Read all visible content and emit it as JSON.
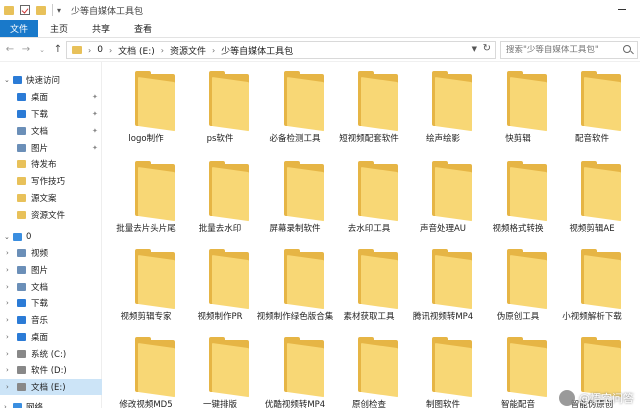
{
  "window": {
    "title": "少等自媒体工具包"
  },
  "ribbon": {
    "tabs": [
      "文件",
      "主页",
      "共享",
      "查看"
    ]
  },
  "address": {
    "crumbs": [
      "0",
      "文档 (E:)",
      "资源文件",
      "少等自媒体工具包"
    ],
    "search_placeholder": "搜索\"少等自媒体工具包\""
  },
  "sidebar": {
    "items": [
      {
        "label": "快速访问",
        "icon": "star-icon",
        "level": 0,
        "expand": "expanded"
      },
      {
        "label": "桌面",
        "icon": "desktop-icon",
        "level": 1,
        "pinned": true
      },
      {
        "label": "下载",
        "icon": "download-icon",
        "level": 1,
        "pinned": true
      },
      {
        "label": "文档",
        "icon": "document-icon",
        "level": 1,
        "pinned": true
      },
      {
        "label": "图片",
        "icon": "picture-icon",
        "level": 1,
        "pinned": true
      },
      {
        "label": "待发布",
        "icon": "folder-icon",
        "level": 1
      },
      {
        "label": "写作技巧",
        "icon": "folder-icon",
        "level": 1
      },
      {
        "label": "源文案",
        "icon": "folder-icon",
        "level": 1
      },
      {
        "label": "资源文件",
        "icon": "folder-icon",
        "level": 1
      },
      {
        "label": "0",
        "icon": "computer-icon",
        "level": 0,
        "expand": "expanded"
      },
      {
        "label": "视频",
        "icon": "video-icon",
        "level": 1,
        "expand": "collapsed"
      },
      {
        "label": "图片",
        "icon": "picture-icon",
        "level": 1,
        "expand": "collapsed"
      },
      {
        "label": "文档",
        "icon": "document-icon",
        "level": 1,
        "expand": "collapsed"
      },
      {
        "label": "下载",
        "icon": "download-icon",
        "level": 1,
        "expand": "collapsed"
      },
      {
        "label": "音乐",
        "icon": "music-icon",
        "level": 1,
        "expand": "collapsed"
      },
      {
        "label": "桌面",
        "icon": "desktop-icon",
        "level": 1,
        "expand": "collapsed"
      },
      {
        "label": "系统 (C:)",
        "icon": "drive-icon",
        "level": 1,
        "expand": "collapsed"
      },
      {
        "label": "软件 (D:)",
        "icon": "drive-icon",
        "level": 1,
        "expand": "collapsed"
      },
      {
        "label": "文档 (E:)",
        "icon": "drive-icon",
        "level": 1,
        "expand": "collapsed",
        "selected": true
      },
      {
        "label": "网络",
        "icon": "network-icon",
        "level": 0,
        "expand": "collapsed"
      }
    ]
  },
  "folders": [
    "logo制作",
    "ps软件",
    "必备检测工具",
    "短视频配套软件",
    "绘声绘影",
    "快剪辑",
    "配音软件",
    "批量去片头片尾",
    "批量去水印",
    "屏幕录制软件",
    "去水印工具",
    "声音处理AU",
    "视频格式转换",
    "视频剪辑AE",
    "视频剪辑专家",
    "视频制作PR",
    "视频制作绿色版合集",
    "素材获取工具",
    "腾讯视频转MP4",
    "伪原创工具",
    "小视频解析下载",
    "修改视频MD5",
    "一键排版",
    "优酷视频转MP4",
    "原创检查",
    "制图软件",
    "智能配音",
    "智能伪原创"
  ],
  "watermark": {
    "text": "@悟空问答"
  },
  "colors": {
    "accent": "#1979ca",
    "folder": "#f8d775",
    "selection": "#cce4f7"
  }
}
